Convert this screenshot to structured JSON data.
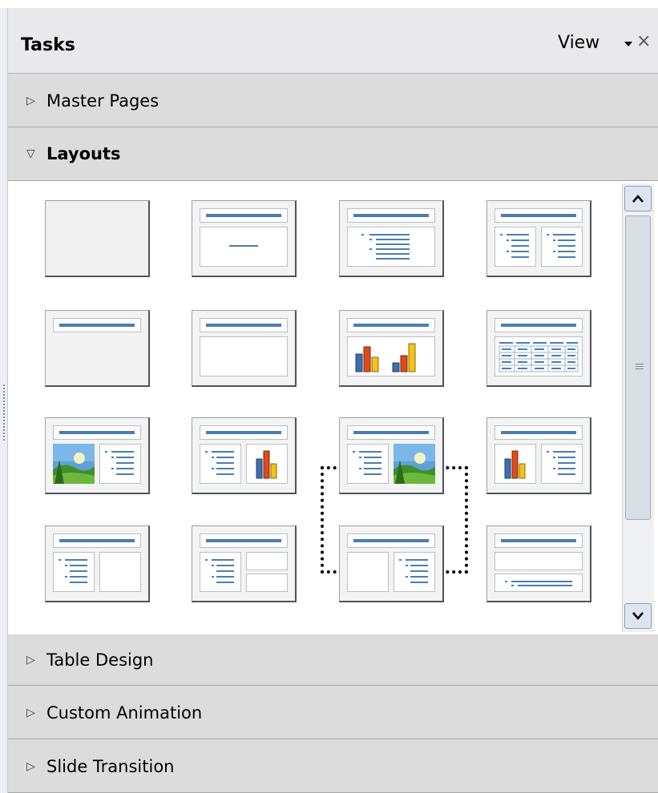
{
  "panel": {
    "title": "Tasks",
    "view_label": "View",
    "close_glyph": "×"
  },
  "sections": {
    "master_pages": {
      "label": "Master Pages",
      "expanded": false,
      "icon": "triangle-right-icon"
    },
    "layouts": {
      "label": "Layouts",
      "expanded": true,
      "icon": "triangle-down-icon"
    },
    "table_design": {
      "label": "Table Design",
      "expanded": false,
      "icon": "triangle-right-icon"
    },
    "custom_animation": {
      "label": "Custom Animation",
      "expanded": false,
      "icon": "triangle-right-icon"
    },
    "slide_transition": {
      "label": "Slide Transition",
      "expanded": false,
      "icon": "triangle-right-icon"
    }
  },
  "glyphs": {
    "collapsed": "▷",
    "expanded": "▽"
  },
  "layouts": {
    "selected_index": 6,
    "items": [
      "blank",
      "title-only-centered",
      "title-content",
      "title-two-content",
      "title-only",
      "title-centered-text",
      "title-chart",
      "title-table",
      "title-clipart-text",
      "title-text-chart",
      "title-text-clipart",
      "title-chart-text",
      "title-content-content-left",
      "title-content-two-right",
      "title-two-left-content-right",
      "title-content-below"
    ]
  },
  "colors": {
    "accent_bar": "#4a7eb2",
    "panel_bg": "#f0f0f0",
    "section_bg": "#dcdcdc"
  }
}
